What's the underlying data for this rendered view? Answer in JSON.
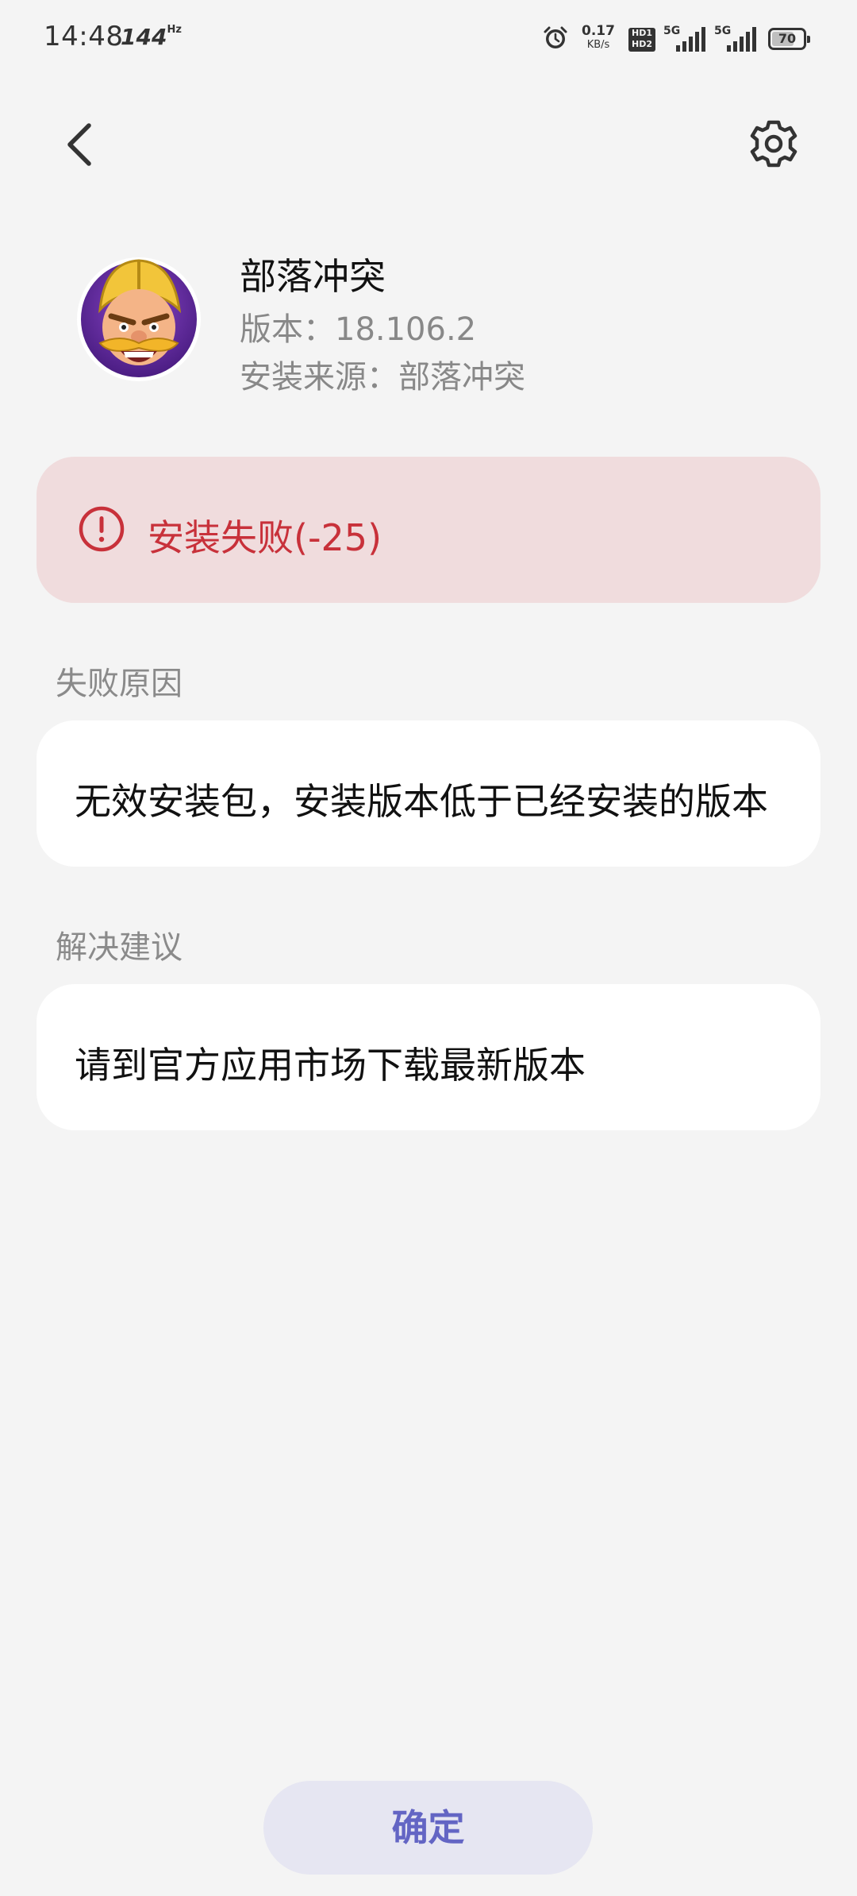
{
  "status_bar": {
    "time": "14:48",
    "refresh_rate": "144",
    "refresh_unit": "Hz",
    "net_speed": "0.17",
    "net_speed_unit": "KB/s",
    "hd_badge_1": "HD1",
    "hd_badge_2": "HD2",
    "signal_1_label": "5G",
    "signal_2_label": "5G",
    "battery_level": "70",
    "icons": [
      "alarm-icon",
      "hd-icon",
      "signal-icon",
      "signal-icon",
      "battery-icon"
    ]
  },
  "header": {
    "back_icon": "chevron-left-icon",
    "settings_icon": "gear-icon"
  },
  "app": {
    "name": "部落冲突",
    "version": "版本：18.106.2",
    "source": "安装来源：部落冲突"
  },
  "error": {
    "text": "安装失败(-25)",
    "icon": "alert-circle-icon",
    "color": "#c8313a",
    "background": "#f0dcdd"
  },
  "failure_reason": {
    "label": "失败原因",
    "text": "无效安装包，安装版本低于已经安装的版本"
  },
  "suggestion": {
    "label": "解决建议",
    "text": "请到官方应用市场下载最新版本"
  },
  "confirm": {
    "label": "确定",
    "color": "#6365c4"
  }
}
